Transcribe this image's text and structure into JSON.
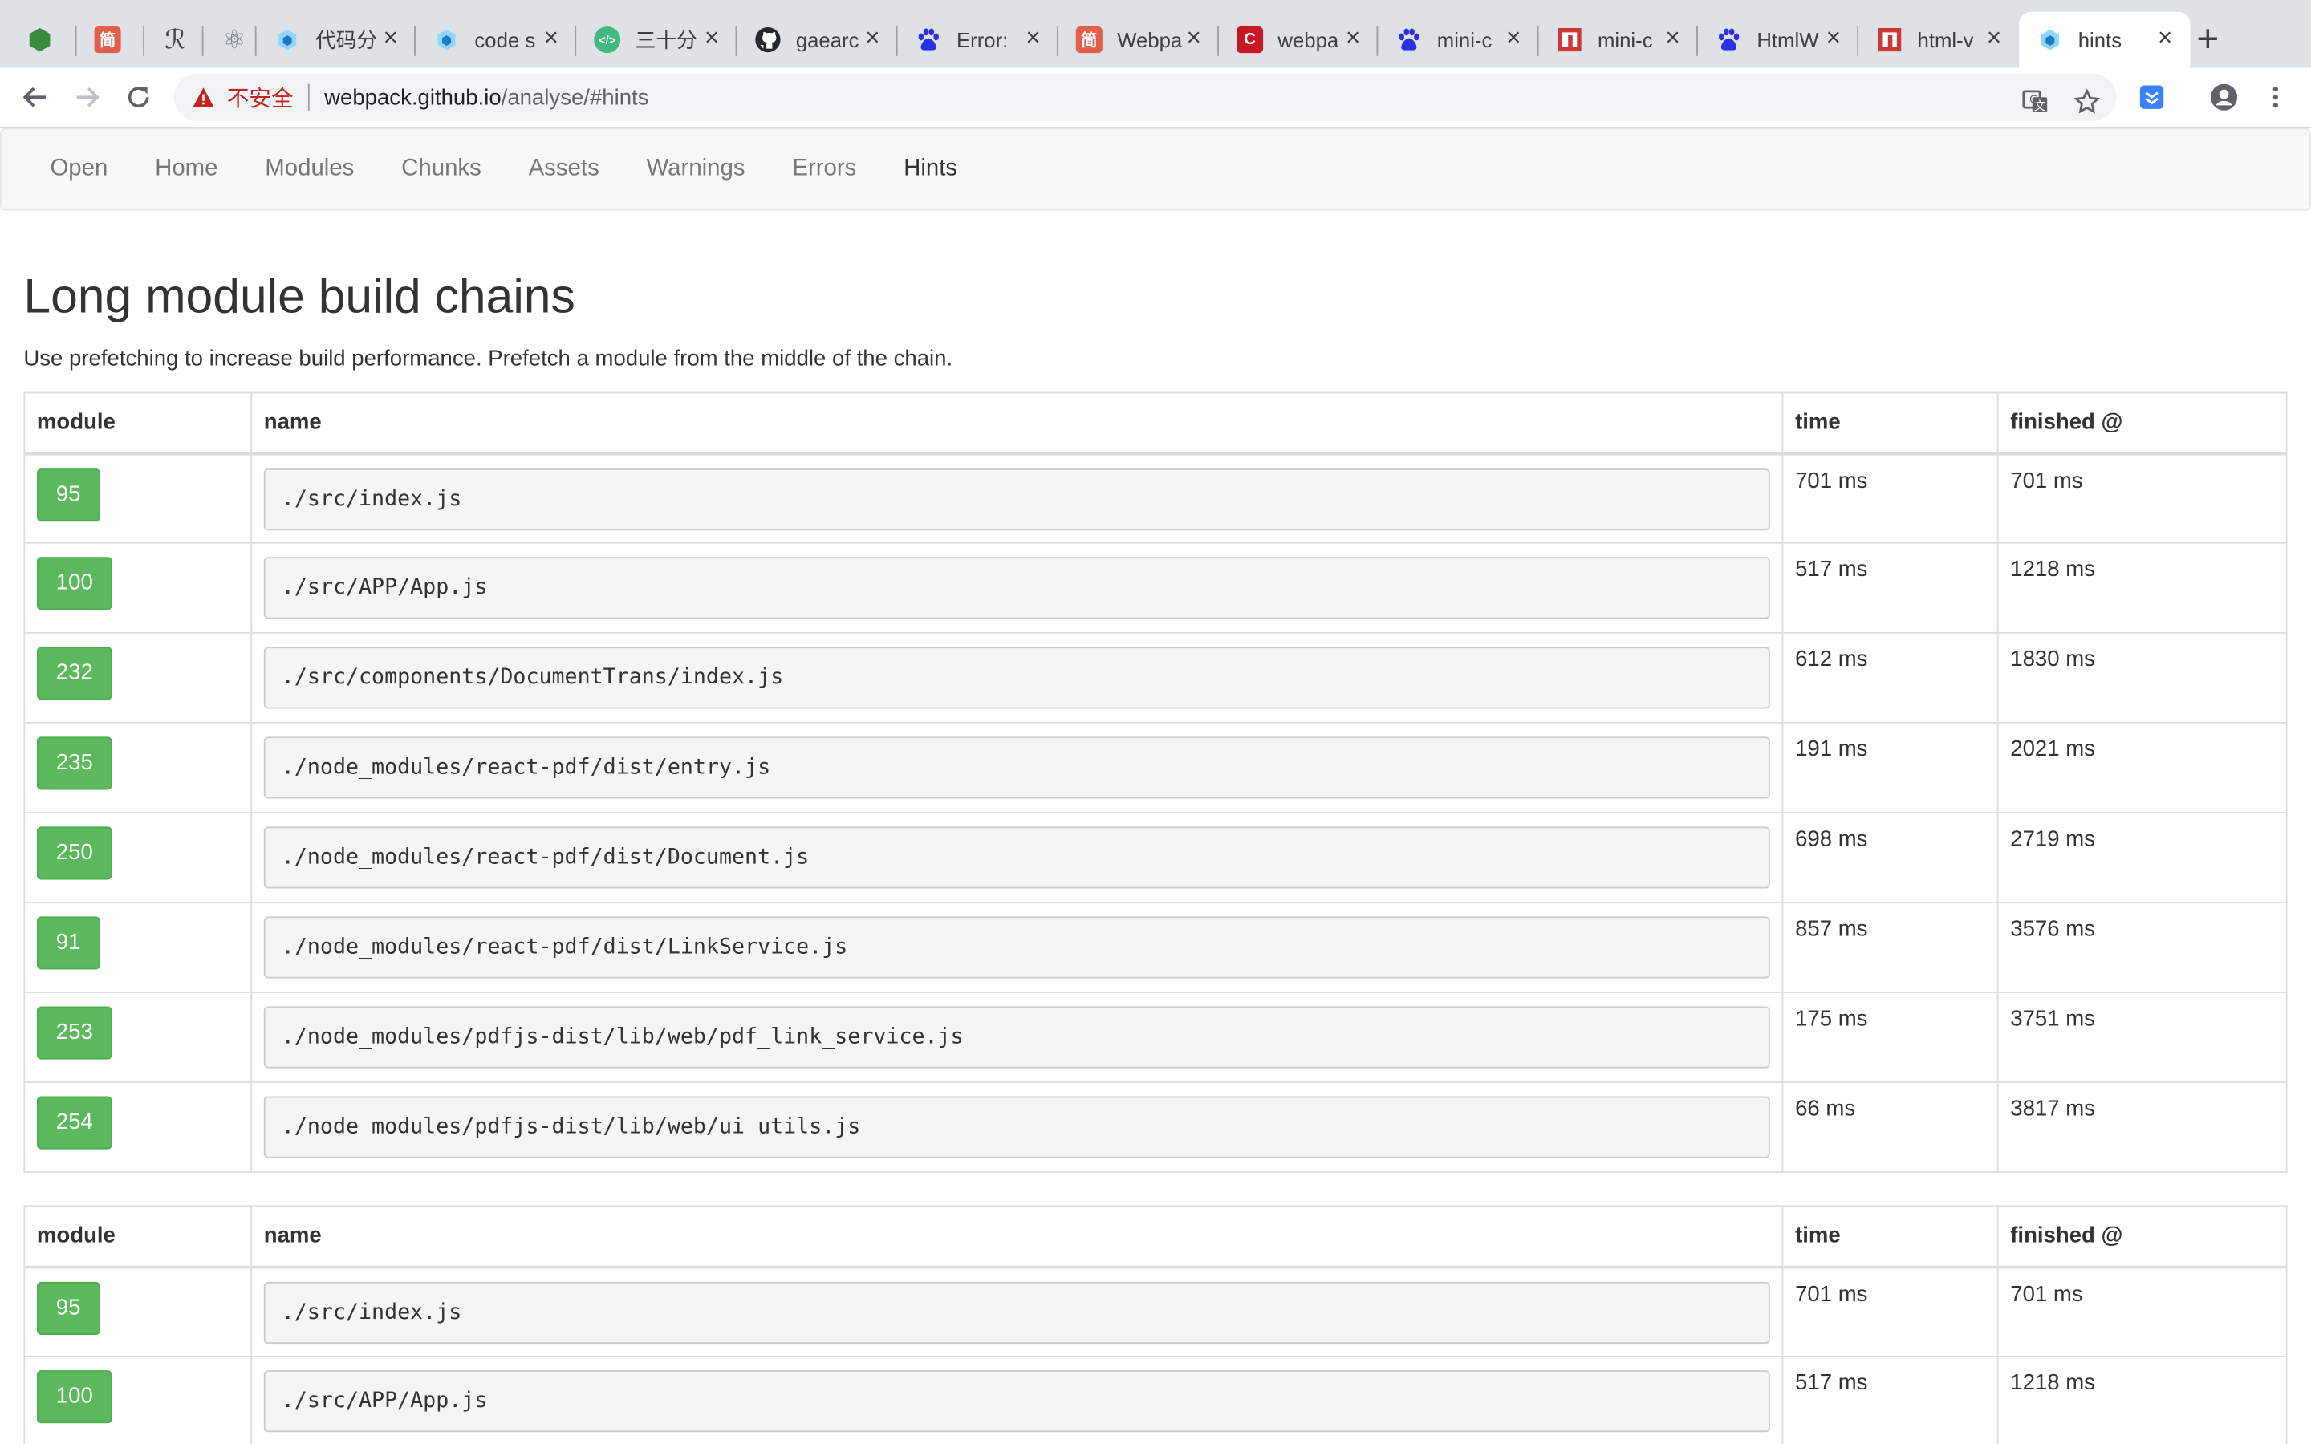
{
  "browser": {
    "tabs": [
      {
        "title": "",
        "icon": "hexagon-icon",
        "color": "#3c8b3c",
        "glyph": ""
      },
      {
        "title": "",
        "icon": "jianshu-icon",
        "color": "#e45e4c",
        "glyph": "简"
      },
      {
        "title": "",
        "icon": "script-icon",
        "color": "#444444",
        "glyph": "ℛ"
      },
      {
        "title": "",
        "icon": "atom-icon",
        "color": "#6a7b8c",
        "glyph": "⚛"
      },
      {
        "title": "代码分",
        "icon": "webpack-icon",
        "color": "#8ed6fb",
        "glyph": ""
      },
      {
        "title": "code s",
        "icon": "webpack-icon",
        "color": "#8ed6fb",
        "glyph": ""
      },
      {
        "title": "三十分",
        "icon": "code-icon",
        "color": "#42b983",
        "glyph": "</>"
      },
      {
        "title": "gaearc",
        "icon": "github-icon",
        "color": "#24292e",
        "glyph": ""
      },
      {
        "title": "Error:",
        "icon": "baidu-icon",
        "color": "#2932e1",
        "glyph": ""
      },
      {
        "title": "Webpa",
        "icon": "jianshu-icon",
        "color": "#e45e4c",
        "glyph": "简"
      },
      {
        "title": "webpa",
        "icon": "csdn-icon",
        "color": "#c81623",
        "glyph": "C"
      },
      {
        "title": "mini-c",
        "icon": "baidu-icon",
        "color": "#2932e1",
        "glyph": ""
      },
      {
        "title": "mini-c",
        "icon": "npm-icon",
        "color": "#cb3837",
        "glyph": ""
      },
      {
        "title": "HtmlW",
        "icon": "baidu-icon",
        "color": "#2932e1",
        "glyph": ""
      },
      {
        "title": "html-v",
        "icon": "npm-icon",
        "color": "#cb3837",
        "glyph": ""
      },
      {
        "title": "hints",
        "icon": "webpack-icon",
        "color": "#8ed6fb",
        "glyph": "",
        "active": true
      }
    ],
    "new_tab_symbol": "+",
    "close_symbol": "×",
    "address": {
      "security_label": "不安全",
      "host": "webpack.github.io",
      "path": "/analyse/#hints"
    }
  },
  "nav": {
    "items": [
      "Open",
      "Home",
      "Modules",
      "Chunks",
      "Assets",
      "Warnings",
      "Errors",
      "Hints"
    ],
    "active": "Hints"
  },
  "page": {
    "title": "Long module build chains",
    "description": "Use prefetching to increase build performance. Prefetch a module from the middle of the chain."
  },
  "table_headers": {
    "module": "module",
    "name": "name",
    "time": "time",
    "finished": "finished @"
  },
  "chains": [
    {
      "rows": [
        {
          "module": "95",
          "name": "./src/index.js",
          "time": "701 ms",
          "finished": "701 ms"
        },
        {
          "module": "100",
          "name": "./src/APP/App.js",
          "time": "517 ms",
          "finished": "1218 ms"
        },
        {
          "module": "232",
          "name": "./src/components/DocumentTrans/index.js",
          "time": "612 ms",
          "finished": "1830 ms"
        },
        {
          "module": "235",
          "name": "./node_modules/react-pdf/dist/entry.js",
          "time": "191 ms",
          "finished": "2021 ms"
        },
        {
          "module": "250",
          "name": "./node_modules/react-pdf/dist/Document.js",
          "time": "698 ms",
          "finished": "2719 ms"
        },
        {
          "module": "91",
          "name": "./node_modules/react-pdf/dist/LinkService.js",
          "time": "857 ms",
          "finished": "3576 ms"
        },
        {
          "module": "253",
          "name": "./node_modules/pdfjs-dist/lib/web/pdf_link_service.js",
          "time": "175 ms",
          "finished": "3751 ms"
        },
        {
          "module": "254",
          "name": "./node_modules/pdfjs-dist/lib/web/ui_utils.js",
          "time": "66 ms",
          "finished": "3817 ms"
        }
      ]
    },
    {
      "rows": [
        {
          "module": "95",
          "name": "./src/index.js",
          "time": "701 ms",
          "finished": "701 ms"
        },
        {
          "module": "100",
          "name": "./src/APP/App.js",
          "time": "517 ms",
          "finished": "1218 ms"
        }
      ]
    }
  ]
}
